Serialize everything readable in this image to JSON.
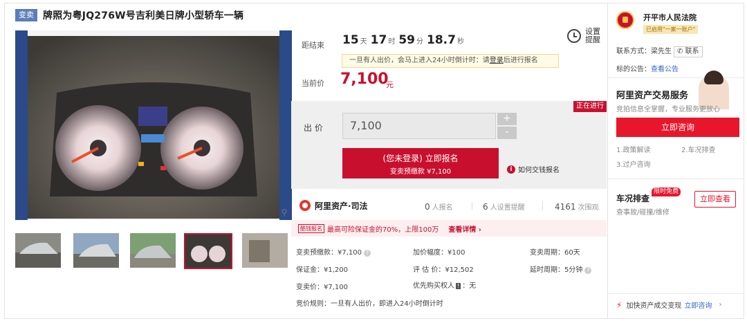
{
  "header": {
    "badge": "变卖",
    "title": "牌照为粤JQ276W号吉利美日牌小型轿车一辆"
  },
  "countdown": {
    "label": "距结束",
    "days": "15",
    "days_unit": "天",
    "hours": "17",
    "hours_unit": "时",
    "minutes": "59",
    "minutes_unit": "分",
    "seconds": "18.7",
    "seconds_unit": "秒"
  },
  "notice": {
    "pre": "一旦有人出价，会马上进入24小时倒计时：请",
    "link": "登录",
    "post": "后进行报名"
  },
  "reminder": {
    "label": "设置提醒"
  },
  "current_price": {
    "label": "当前价",
    "value": "7,100",
    "unit": "元"
  },
  "bid": {
    "status": "正在进行",
    "label": "出 价",
    "input_value": "7,100",
    "plus": "+",
    "minus": "-",
    "btn_line1": "(您未登录) 立即报名",
    "btn_line2": "变卖预缴款 ¥7,100",
    "howto": "如何交钱报名"
  },
  "brand": {
    "name": "阿里资产·司法",
    "signup_count": "0",
    "signup_label": "人报名",
    "remind_count": "6",
    "remind_label": "人设置提醒",
    "view_count": "4161",
    "view_label": "次围观"
  },
  "promo": {
    "tag": "酷钱报名",
    "text": "最高可险保证金的70%，上限100万",
    "more": "查看详情 ›"
  },
  "info": {
    "deposit": "变卖预缴款：¥7,100",
    "increment": "加价幅度：¥100",
    "period": "变卖周期：60天",
    "margin": "保证金：¥1,200",
    "appraisal": "评 估 价：¥12,502",
    "delay": "延时周期：5分钟",
    "sell_price": "变卖价：¥7,100",
    "priority_pre": "优先购买权人",
    "priority_tag": "!",
    "priority_post": "：无",
    "rule": "竞价规则：一旦有人出价，即进入24小时倒计时"
  },
  "court": {
    "name": "开平市人民法院",
    "badge": "已启用\"一案一账户\"",
    "contact_label": "联系方式：梁先生",
    "contact_btn": "联系",
    "notice_label": "标的公告：",
    "notice_link": "查看公告"
  },
  "service": {
    "title": "阿里资产交易服务",
    "subtitle": "竞拍信息全掌握，专业服务更放心",
    "consult_btn": "立即咨询",
    "items": [
      "1.政策解读",
      "2.车况排查",
      "3.过户咨询"
    ]
  },
  "car_check": {
    "title": "车况排查",
    "free_tag": "限时免费",
    "subtitle": "查事故/碰撞/维修",
    "btn": "立即查看"
  },
  "speed": {
    "text": "加快资产成交变现",
    "link": "立即咨询"
  },
  "icons": {
    "zoom": "search-icon",
    "clock": "clock-icon",
    "info": "info-icon",
    "brand": "ali-asset-logo",
    "court": "court-emblem-icon",
    "speed": "fast-icon"
  }
}
